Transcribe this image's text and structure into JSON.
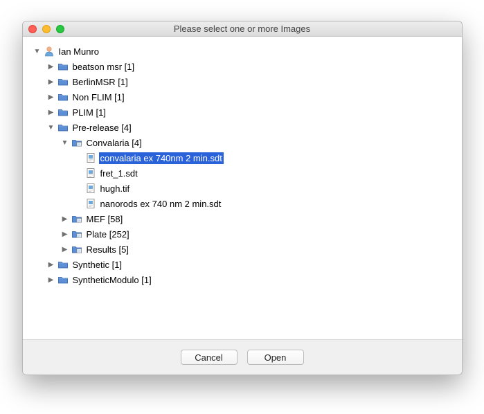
{
  "window": {
    "title": "Please select one or more Images"
  },
  "buttons": {
    "cancel": "Cancel",
    "open": "Open"
  },
  "tree": {
    "root": {
      "label": "Ian Munro",
      "children": {
        "beatson": {
          "label": "beatson msr [1]"
        },
        "berlin": {
          "label": "BerlinMSR [1]"
        },
        "nonflim": {
          "label": "Non FLIM [1]"
        },
        "plim": {
          "label": "PLIM [1]"
        },
        "prerelease": {
          "label": "Pre-release [4]",
          "children": {
            "convalaria": {
              "label": "Convalaria [4]",
              "files": {
                "f0": "convalaria ex 740nm 2 min.sdt",
                "f1": "fret_1.sdt",
                "f2": "hugh.tif",
                "f3": "nanorods ex 740 nm 2 min.sdt"
              }
            },
            "mef": {
              "label": "MEF [58]"
            },
            "plate": {
              "label": "Plate [252]"
            },
            "results": {
              "label": "Results [5]"
            }
          }
        },
        "synthetic": {
          "label": "Synthetic [1]"
        },
        "synthmod": {
          "label": "SyntheticModulo [1]"
        }
      }
    }
  }
}
